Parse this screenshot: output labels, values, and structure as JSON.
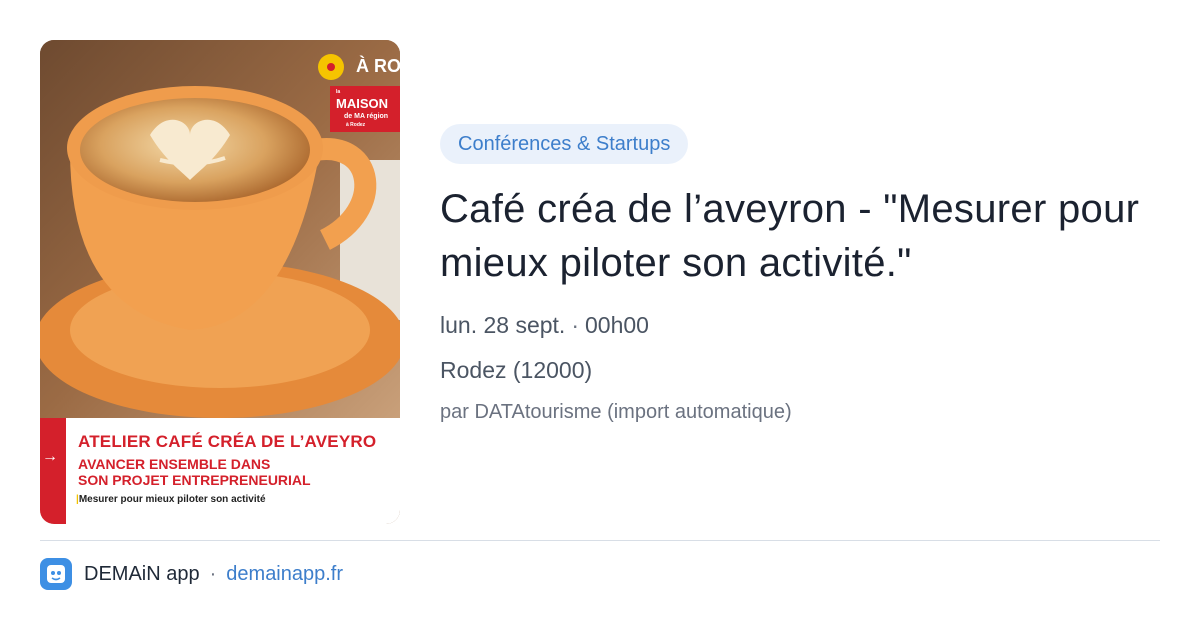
{
  "card": {
    "image": {
      "place": "À RO",
      "logo": {
        "line0": "la",
        "line1": "MAISON",
        "line2": "de MA région",
        "line3": "à Rodez"
      },
      "banner": {
        "line1": "ATELIER CAFÉ CRÉA DE L’AVEYRO",
        "line2": "AVANCER ENSEMBLE DANS",
        "line3": "SON PROJET ENTREPRENEURIAL",
        "line4": "Mesurer pour mieux piloter son activité"
      }
    },
    "category": "Conférences & Startups",
    "title": "Café créa de l’aveyron - \"Mesurer pour mieux piloter son activité.\"",
    "date": "lun. 28 sept.",
    "separator": "·",
    "time": "00h00",
    "location": "Rodez (12000)",
    "source": "par DATAtourisme (import automatique)"
  },
  "footer": {
    "app_icon": "demain-app-icon",
    "app_name": "DEMAiN app",
    "separator": "·",
    "domain": "demainapp.fr"
  },
  "colors": {
    "accent": "#3d7ecb",
    "badge_bg": "#eaf1fb",
    "brand_red": "#d4202b",
    "cup_orange": "#f0a253"
  }
}
